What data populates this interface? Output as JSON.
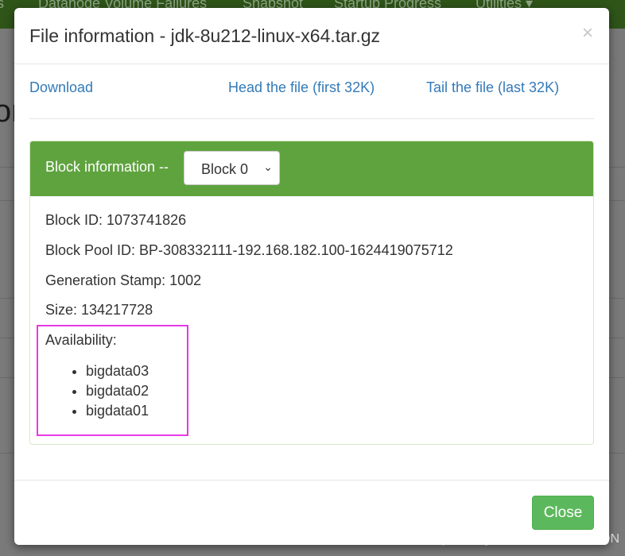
{
  "background": {
    "nav_items": [
      "s",
      "Datanode Volume Failures",
      "Snapshot",
      "Startup Progress",
      "Utilities ▾"
    ],
    "title_fragment": "or"
  },
  "modal": {
    "title": "File information - jdk-8u212-linux-x64.tar.gz",
    "close_x": "×",
    "links": {
      "download": "Download",
      "head": "Head the file (first 32K)",
      "tail": "Tail the file (last 32K)"
    },
    "block": {
      "header": "Block information --",
      "select_value": "Block 0",
      "id": "Block ID: 1073741826",
      "pool": "Block Pool ID: BP-308332111-192.168.182.100-1624419075712",
      "gen": "Generation Stamp: 1002",
      "size": "Size: 134217728",
      "availability": "Availability:",
      "nodes": [
        "bigdata03",
        "bigdata02",
        "bigdata01"
      ]
    },
    "close_button": "Close"
  },
  "watermark": "https://blog.csdn.net/nmsLLCSDN",
  "colors": {
    "panel_header": "#5fa33f",
    "close_button": "#5cb85c",
    "link": "#337ab7",
    "highlight": "#e639e6"
  }
}
